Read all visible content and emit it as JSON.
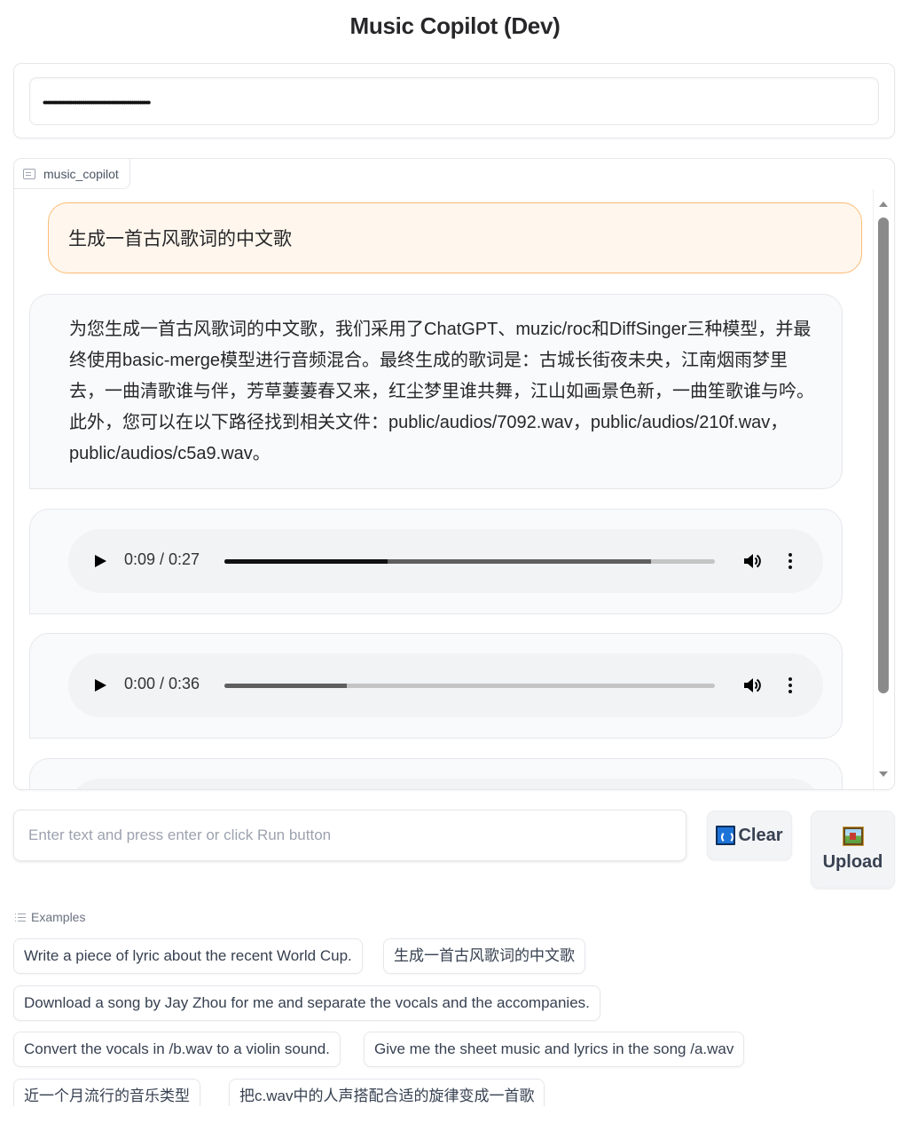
{
  "app": {
    "title": "Music Copilot (Dev)"
  },
  "api_key": {
    "masked_value": "••••••••••••••••••••••••••••••••••••••••••••••••••••"
  },
  "chatbot": {
    "label": "music_copilot",
    "messages": [
      {
        "role": "user",
        "type": "text",
        "text": "生成一首古风歌词的中文歌"
      },
      {
        "role": "bot",
        "type": "text",
        "text": "为您生成一首古风歌词的中文歌，我们采用了ChatGPT、muzic/roc和DiffSinger三种模型，并最终使用basic-merge模型进行音频混合。最终生成的歌词是：古城长街夜未央，江南烟雨梦里去，一曲清歌谁与伴，芳草萋萋春又来，红尘梦里谁共舞，江山如画景色新，一曲笙歌谁与吟。此外，您可以在以下路径找到相关文件：public/audios/7092.wav，public/audios/210f.wav，public/audios/c5a9.wav。"
      },
      {
        "role": "bot",
        "type": "audio",
        "time_display": "0:09 / 0:27",
        "played_fraction": 0.333,
        "buffered_fraction": 0.87
      },
      {
        "role": "bot",
        "type": "audio",
        "time_display": "0:00 / 0:36",
        "played_fraction": 0.0,
        "buffered_fraction": 0.25
      },
      {
        "role": "bot",
        "type": "audio",
        "time_display": "",
        "played_fraction": 0.0,
        "buffered_fraction": 0.0
      }
    ]
  },
  "input": {
    "placeholder": "Enter text and press enter or click Run button",
    "value": ""
  },
  "buttons": {
    "clear_label": "Clear",
    "upload_label": "Upload"
  },
  "icons": {
    "clear": "refresh-icon",
    "upload": "image-icon",
    "chat_label": "chat-bubble-icon",
    "examples": "list-icon",
    "play": "play-icon",
    "volume": "volume-icon",
    "more": "more-vertical-icon"
  },
  "examples": {
    "label": "Examples",
    "items": [
      "Write a piece of lyric about the recent World Cup.",
      "生成一首古风歌词的中文歌",
      "Download a song by Jay Zhou for me and separate the vocals and the accompanies.",
      "Convert the vocals in /b.wav to a violin sound.",
      "Give me the sheet music and lyrics in the song /a.wav",
      "近一个月流行的音乐类型",
      "把c.wav中的人声搭配合适的旋律变成一首歌"
    ]
  },
  "colors": {
    "user_bubble_bg": "#fff7ed",
    "user_bubble_border": "#fdba74",
    "bot_bubble_bg": "#f9fafb",
    "audio_player_bg": "#f1f3f4",
    "clear_icon_blue": "#1e73d8"
  }
}
